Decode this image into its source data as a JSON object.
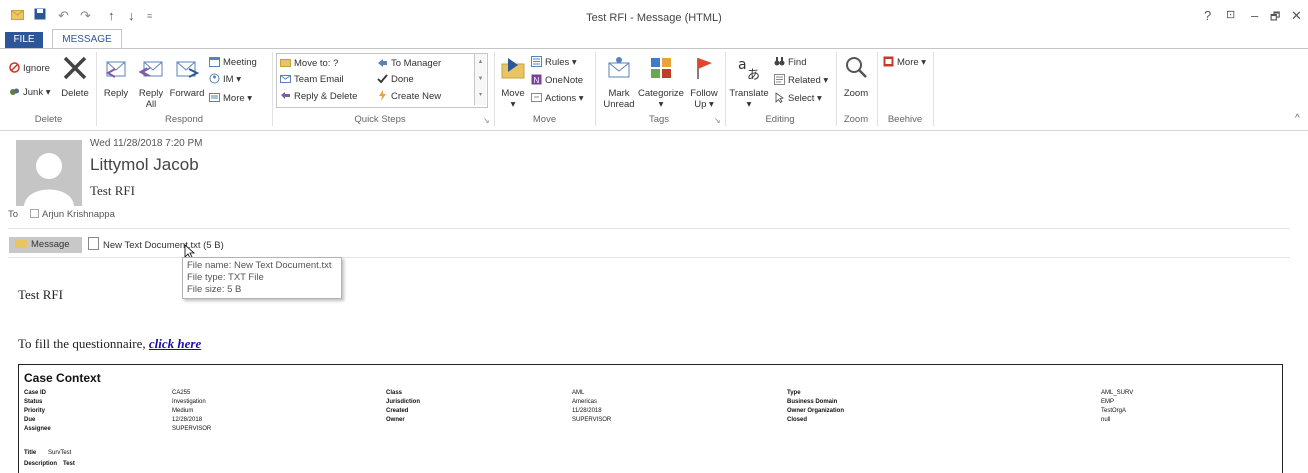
{
  "window": {
    "title": "Test RFI - Message (HTML)",
    "controls": [
      "?",
      "⊡",
      "–",
      "🗗",
      "✕"
    ]
  },
  "tabs": [
    {
      "label": "FILE"
    },
    {
      "label": "MESSAGE"
    }
  ],
  "ribbon": {
    "delete_group": {
      "label": "Delete",
      "ignore": "Ignore",
      "junk": "Junk ▾",
      "delete": "Delete"
    },
    "respond_group": {
      "label": "Respond",
      "reply": "Reply",
      "reply_all_line1": "Reply",
      "reply_all_line2": "All",
      "forward": "Forward",
      "meeting": "Meeting",
      "im": "IM ▾",
      "more": "More ▾"
    },
    "quick_steps": {
      "label": "Quick Steps",
      "items": [
        "Move to: ?",
        "Team Email",
        "Reply & Delete",
        "To Manager",
        "Done",
        "Create New"
      ]
    },
    "move_group": {
      "label": "Move",
      "move": "Move",
      "move_arrow": "▾",
      "rules": "Rules ▾",
      "onenote": "OneNote",
      "actions": "Actions ▾"
    },
    "tags_group": {
      "label": "Tags",
      "mark_unread_1": "Mark",
      "mark_unread_2": "Unread",
      "categorize_1": "Categorize",
      "categorize_2": "▾",
      "follow_up_1": "Follow",
      "follow_up_2": "Up ▾"
    },
    "editing_group": {
      "label": "Editing",
      "translate": "Translate",
      "translate_arrow": "▾",
      "find": "Find",
      "related": "Related ▾",
      "select": "Select ▾"
    },
    "zoom_group": {
      "label": "Zoom",
      "zoom": "Zoom"
    },
    "beehive_group": {
      "label": "Beehive",
      "more": "More ▾"
    },
    "collapse": "^"
  },
  "message": {
    "date": "Wed 11/28/2018 7:20 PM",
    "sender": "Littymol Jacob",
    "subject": "Test RFI",
    "to_label": "To",
    "to_name": "Arjun Krishnappa",
    "attachments": {
      "message_tab": "Message",
      "file": "New Text Document.txt (5 B)"
    },
    "tooltip": {
      "line1": "File name:  New Text Document.txt",
      "line2": "File type:  TXT File",
      "line3": "File size:  5 B"
    },
    "body_title": "Test RFI",
    "body_text": "To fill the questionnaire, ",
    "body_link": "click here"
  },
  "case_context": {
    "title": "Case Context",
    "rows": [
      [
        "Case ID",
        "CA255",
        "Class",
        "AML",
        "Type",
        "AML_SURV"
      ],
      [
        "Status",
        "Investigation",
        "Jurisdiction",
        "Americas",
        "Business Domain",
        "EMP"
      ],
      [
        "Priority",
        "Medium",
        "Created",
        "11/28/2018",
        "Owner Organization",
        "TestOrgA"
      ],
      [
        "Due",
        "12/28/2018",
        "Owner",
        "SUPERVISOR",
        "Closed",
        "null"
      ],
      [
        "Assignee",
        "SUPERVISOR",
        "",
        "",
        "",
        ""
      ]
    ],
    "title_label": "Title",
    "title_value": "SurvTest",
    "description_label": "Description",
    "description_value": "Test"
  },
  "colors": {
    "accent": "#2b579a",
    "link": "#1a0dab"
  }
}
